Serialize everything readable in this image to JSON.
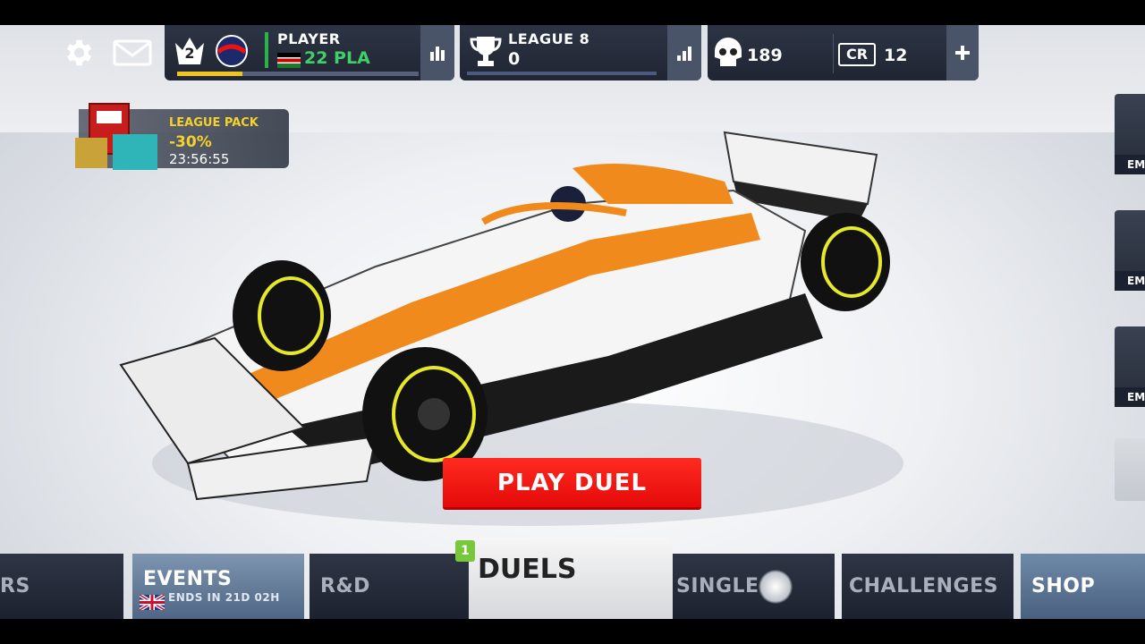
{
  "hud": {
    "settings_icon": "gear-icon",
    "mail_icon": "envelope-icon",
    "player": {
      "level": "2",
      "name": "PLAYER",
      "team_code": "22 PLA",
      "flag": "kenya-flag",
      "xp_progress": 0.27,
      "stats_icon": "bar-chart-icon"
    },
    "league": {
      "title": "LEAGUE 8",
      "points": "0",
      "trophy_icon": "trophy-icon",
      "stats_icon": "signal-icon"
    },
    "currency": {
      "skull_value": "189",
      "cr_label": "CR",
      "cr_value": "12",
      "add_icon": "plus-icon"
    }
  },
  "league_pack": {
    "title": "LEAGUE PACK",
    "discount": "-30%",
    "timer": "23:56:55"
  },
  "side_cards": [
    {
      "label": "EM"
    },
    {
      "label": "EM"
    },
    {
      "label": "EM"
    }
  ],
  "play_button": {
    "label": "PLAY DUEL"
  },
  "nav": {
    "tab_partial_left": "RS",
    "tab_events": "EVENTS",
    "events_sub": "ENDS IN 21D 02H",
    "tab_rd": "R&D",
    "tab_duels": "DUELS",
    "duels_badge": "1",
    "tab_single": "SINGLE",
    "tab_challenges": "CHALLENGES",
    "tab_shop": "SHOP"
  },
  "colors": {
    "accent_red": "#e40a0a",
    "livery_orange": "#f08a1c",
    "tyre_yellow": "#e6e82a",
    "badge_green": "#79c83b",
    "xp_yellow": "#f2c31b"
  }
}
